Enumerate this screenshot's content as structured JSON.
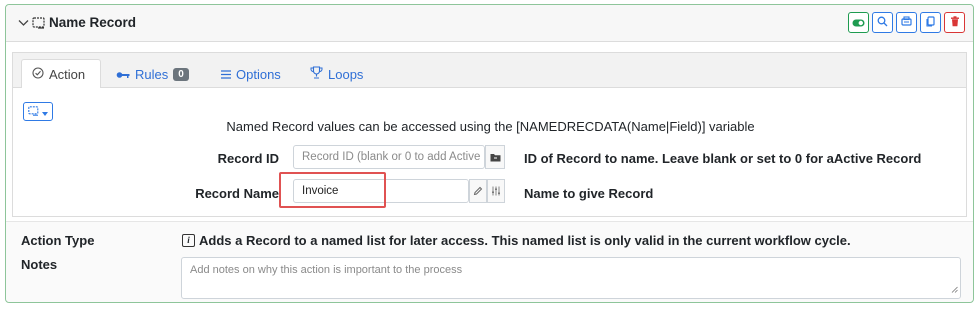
{
  "header": {
    "title": "Name Record",
    "tools": [
      "toggle-icon",
      "search-icon",
      "print-icon",
      "copy-icon",
      "trash-icon"
    ]
  },
  "tabs": [
    {
      "label": "Action",
      "icon": "check-circle-icon",
      "active": true
    },
    {
      "label": "Rules",
      "icon": "key-icon",
      "badge": "0"
    },
    {
      "label": "Options",
      "icon": "menu-icon"
    },
    {
      "label": "Loops",
      "icon": "trophy-icon"
    }
  ],
  "info_text": "Named Record values can be accessed using the [NAMEDRECDATA(Name|Field)] variable",
  "fields": {
    "record_id": {
      "label": "Record ID",
      "placeholder": "Record ID (blank or 0 to add Active",
      "help": "ID of Record to name. Leave blank or set to 0 for aActive Record"
    },
    "record_name": {
      "label": "Record Name",
      "value": "Invoice",
      "help": "Name to give Record"
    }
  },
  "bottom": {
    "action_type_label": "Action Type",
    "action_type_desc": "Adds a Record to a named list for later access. This named list is only valid in the current workflow cycle.",
    "notes_label": "Notes",
    "notes_placeholder": "Add notes on why this action is important to the process"
  },
  "colors": {
    "card_border": "#8ec59a",
    "primary": "#2f7ae5",
    "success": "#1e9b50",
    "danger": "#d93636",
    "highlight": "#e05252"
  }
}
